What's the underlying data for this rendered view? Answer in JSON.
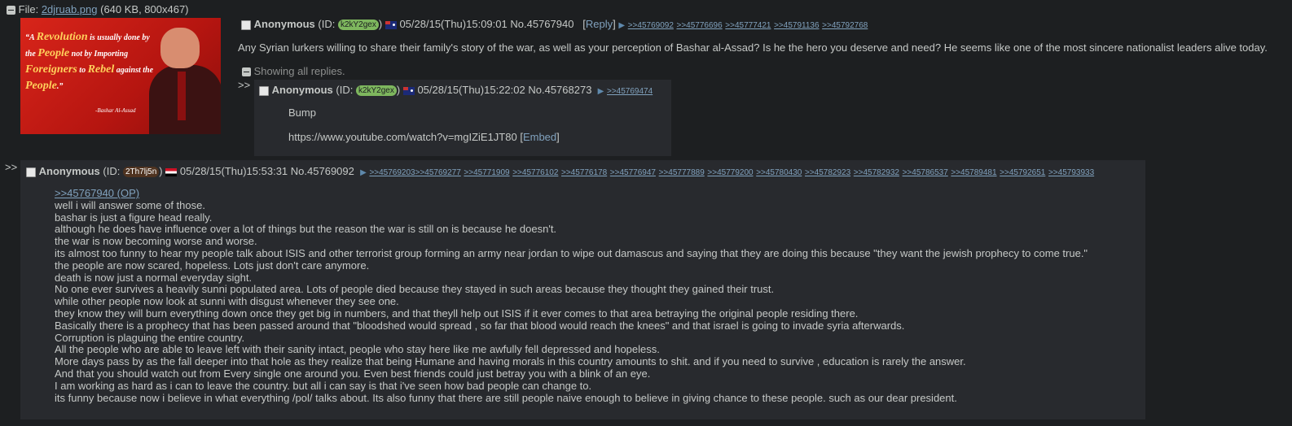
{
  "file": {
    "label": "File:",
    "filename": "2djruab.png",
    "meta": "(640 KB, 800x467)"
  },
  "image": {
    "quote_parts": [
      "“A ",
      "Revolution",
      " is usually done by the ",
      "People",
      " not by Importing ",
      "Foreigners",
      " to ",
      "Rebel",
      " against the ",
      "People",
      ".”"
    ],
    "signature": "-Bashar Al-Assad"
  },
  "op": {
    "name": "Anonymous",
    "id_prefix": "(ID: ",
    "id": "k2kY2gex",
    "id_suffix": ")",
    "id_color": "#7eb75e",
    "datetime": "05/28/15(Thu)15:09:01",
    "post_no": "No.45767940",
    "reply_link": "Reply",
    "backlinks": [
      ">>45769092",
      ">>45776696",
      ">>45777421",
      ">>45791136",
      ">>45792768"
    ],
    "text": "Any Syrian lurkers willing to share their family's story of the war, as well as your perception of Bashar al-Assad? Is he the hero you deserve and need? He seems like one of the most sincere nationalist leaders alive today."
  },
  "showing_replies": "Showing all replies.",
  "reply1": {
    "arrows": ">>",
    "name": "Anonymous",
    "id_prefix": "(ID: ",
    "id": "k2kY2gex",
    "id_suffix": ")",
    "datetime": "05/28/15(Thu)15:22:02",
    "post_no": "No.45768273",
    "backlinks": [
      ">>45769474"
    ],
    "line1": "Bump",
    "url": "https://www.youtube.com/watch?v=mgIZiE1JT80",
    "embed": "Embed"
  },
  "reply2": {
    "arrows": ">>",
    "name": "Anonymous",
    "id_prefix": "(ID: ",
    "id": "2Th7lj5n",
    "id_suffix": ")",
    "id_color": "#4f3320",
    "datetime": "05/28/15(Thu)15:53:31",
    "post_no": "No.45769092",
    "backlinks": [
      ">>45769203",
      ">>45769277",
      ">>45771909",
      ">>45776102",
      ">>45776178",
      ">>45776947",
      ">>45777889",
      ">>45779200",
      ">>45780430",
      ">>45782923",
      ">>45782932",
      ">>45786537",
      ">>45789481",
      ">>45792651",
      ">>45793933"
    ],
    "op_link": ">>45767940 (OP)",
    "lines": [
      "well i will answer some of those.",
      "bashar is just a figure head really.",
      "although he does have influence over a lot of things but the reason the war is still on is because he doesn't.",
      "the war is now becoming worse and worse.",
      "its almost too funny to hear my people talk about ISIS and other terrorist group forming an army near jordan to wipe out damascus and saying that they are doing this because \"they want the jewish prophecy to come true.\"",
      "the people are now scared, hopeless. Lots just don't care anymore.",
      "death is now just a normal everyday sight.",
      "No one ever survives a heavily sunni populated area. Lots of people died because they stayed in such areas because they thought they gained their trust.",
      "while other people now look at sunni with disgust whenever they see one.",
      "they know they will burn everything down once they get big in numbers, and that theyll help out ISIS if it ever comes to that area betraying the original people residing there.",
      "Basically there is a prophecy that has been passed around that \"bloodshed would spread , so far that blood would reach the knees\" and that israel is going to invade syria afterwards.",
      "Corruption is plaguing the entire country.",
      "All the people who are able to leave left with their sanity intact, people who stay here like me awfully fell depressed and hopeless.",
      "More days pass by as the fall deeper into that hole as they realize that being Humane and having morals in this country amounts to shit. and if you need to survive , education is rarely the answer.",
      "And that you should watch out from Every single one around you. Even best friends could just betray you with a blink of an eye.",
      "I am working as hard as i can to leave the country. but all i can say is that i've seen how bad people can change to.",
      "its funny because now i believe in what everything /pol/ talks about. Its also funny that there are still people naive enough to believe in giving chance to these people. such as our dear president."
    ]
  },
  "colors": {
    "background": "#1d1f21",
    "reply_background": "#282a2e",
    "text": "#c5c8c6",
    "link": "#81a2be"
  }
}
